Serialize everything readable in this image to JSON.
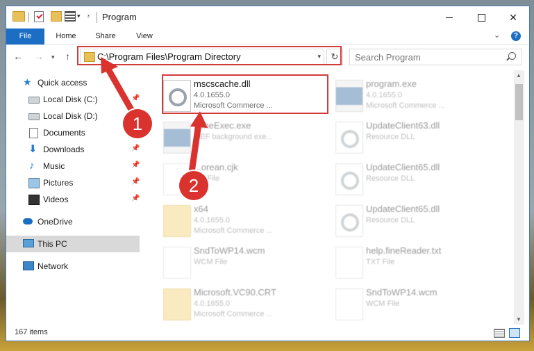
{
  "window": {
    "title": "Program"
  },
  "ribbon": {
    "tabs": [
      "File",
      "Home",
      "Share",
      "View"
    ]
  },
  "navbar": {
    "address": "C:\\Program Files\\Program Directory",
    "search_placeholder": "Search Program"
  },
  "sidebar": {
    "items": [
      {
        "label": "Quick access",
        "icon": "star-icon"
      },
      {
        "label": "Local Disk (C:)",
        "icon": "disk-icon"
      },
      {
        "label": "Local Disk (D:)",
        "icon": "disk-icon"
      },
      {
        "label": "Documents",
        "icon": "documents-icon"
      },
      {
        "label": "Downloads",
        "icon": "download-icon"
      },
      {
        "label": "Music",
        "icon": "music-icon"
      },
      {
        "label": "Pictures",
        "icon": "pictures-icon"
      },
      {
        "label": "Videos",
        "icon": "videos-icon"
      },
      {
        "label": "OneDrive",
        "icon": "cloud-icon"
      },
      {
        "label": "This PC",
        "icon": "computer-icon"
      },
      {
        "label": "Network",
        "icon": "network-icon"
      }
    ]
  },
  "files": [
    {
      "name": "mscscache.dll",
      "line2": "4.0.1655.0",
      "line3": "Microsoft Commerce ...",
      "icon": "dll-icon"
    },
    {
      "name": "program.exe",
      "line2": "4.0.1655.0",
      "line3": "Microsoft Commerce ...",
      "icon": "exe-icon"
    },
    {
      "name": "...meExec.exe",
      "line2": "...EF background exe...",
      "line3": "",
      "icon": "exe-icon"
    },
    {
      "name": "UpdateClient63.dll",
      "line2": "Resource DLL",
      "line3": "",
      "icon": "dll-icon"
    },
    {
      "name": "...orean.cjk",
      "line2": "...K File",
      "line3": "",
      "icon": "file-icon"
    },
    {
      "name": "UpdateClient65.dll",
      "line2": "Resource DLL",
      "line3": "",
      "icon": "dll-icon"
    },
    {
      "name": "x64",
      "line2": "4.0.1655.0",
      "line3": "Microsoft Commerce ...",
      "icon": "folder-icon"
    },
    {
      "name": "UpdateClient65.dll",
      "line2": "Resource DLL",
      "line3": "",
      "icon": "dll-icon"
    },
    {
      "name": "SndToWP14.wcm",
      "line2": "WCM File",
      "line3": "",
      "icon": "file-icon"
    },
    {
      "name": "help.fineReader.txt",
      "line2": "TXT File",
      "line3": "",
      "icon": "txt-icon"
    },
    {
      "name": "Microsoft.VC90.CRT",
      "line2": "4.0.1655.0",
      "line3": "Microsoft Commerce ...",
      "icon": "folder-icon"
    },
    {
      "name": "SndToWP14.wcm",
      "line2": "WCM File",
      "line3": "",
      "icon": "file-icon"
    }
  ],
  "status": {
    "count": "167 items"
  },
  "annotations": {
    "step1": "1",
    "step2": "2"
  }
}
